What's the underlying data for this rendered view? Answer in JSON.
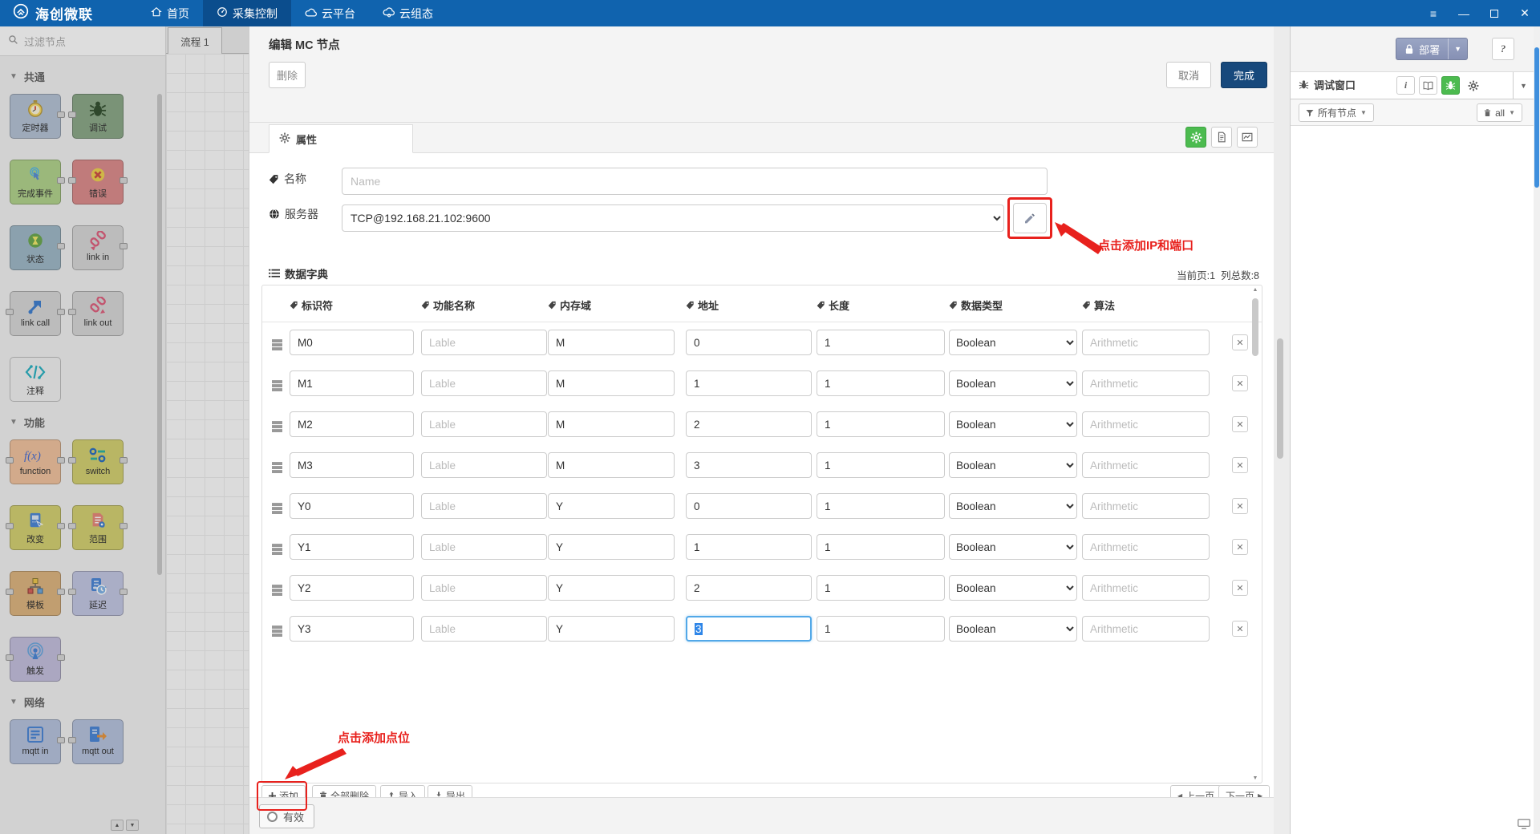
{
  "colors": {
    "navbar": "#1063ae",
    "navbar_active": "#0b4d8d",
    "done_button": "#17497c",
    "annotation_red": "#e8211d",
    "green": "#4cbb4f",
    "focus_blue": "#52a8e8",
    "selection_blue": "#2f86e8",
    "deploy": "#8e99bb"
  },
  "navbar": {
    "brand": "海创微联",
    "items": [
      {
        "label": "首页",
        "icon": "home-icon",
        "active": false
      },
      {
        "label": "采集控制",
        "icon": "gauge-icon",
        "active": true
      },
      {
        "label": "云平台",
        "icon": "cloud-icon",
        "active": false
      },
      {
        "label": "云组态",
        "icon": "cloud-gear-icon",
        "active": false
      }
    ]
  },
  "palette": {
    "search_placeholder": "过滤节点",
    "sections": [
      {
        "title": "共通",
        "nodes": [
          {
            "key": "timer",
            "label": "定时器",
            "color": "#b5c3d6",
            "icon": "timer",
            "ports": "r"
          },
          {
            "key": "debug",
            "label": "调试",
            "color": "#8ba888",
            "icon": "debug",
            "ports": "l"
          },
          {
            "key": "complete",
            "label": "完成事件",
            "color": "#b2d48c",
            "icon": "complete",
            "ports": "r"
          },
          {
            "key": "catch-error",
            "label": "错误",
            "color": "#dd8c8c",
            "icon": "error",
            "ports": "lr"
          },
          {
            "key": "status",
            "label": "状态",
            "color": "#9fb9c8",
            "icon": "status",
            "ports": "r"
          },
          {
            "key": "link-in",
            "label": "link in",
            "color": "#d9d9d9",
            "icon": "linkin",
            "ports": "r"
          },
          {
            "key": "link-call",
            "label": "link call",
            "color": "#d9d9d9",
            "icon": "linkcall",
            "ports": "lr"
          },
          {
            "key": "link-out",
            "label": "link out",
            "color": "#d9d9d9",
            "icon": "linkout",
            "ports": "l"
          },
          {
            "key": "comment",
            "label": "注释",
            "color": "#f2f2f2",
            "icon": "comment",
            "ports": ""
          }
        ]
      },
      {
        "title": "功能",
        "nodes": [
          {
            "key": "function",
            "label": "function",
            "color": "#f2c49f",
            "icon": "function",
            "ports": "lr"
          },
          {
            "key": "switch",
            "label": "switch",
            "color": "#d5d271",
            "icon": "switch",
            "ports": "lr"
          },
          {
            "key": "change",
            "label": "改变",
            "color": "#d5d271",
            "icon": "change",
            "ports": "lr"
          },
          {
            "key": "range",
            "label": "范围",
            "color": "#d5d271",
            "icon": "range",
            "ports": "lr"
          },
          {
            "key": "template",
            "label": "模板",
            "color": "#dfb57f",
            "icon": "template",
            "ports": "lr"
          },
          {
            "key": "delay",
            "label": "延迟",
            "color": "#c4c8e4",
            "icon": "delay",
            "ports": "lr"
          },
          {
            "key": "trigger",
            "label": "触发",
            "color": "#c5c0de",
            "icon": "trigger",
            "ports": "lr"
          }
        ]
      },
      {
        "title": "网络",
        "nodes": [
          {
            "key": "mqtt-in",
            "label": "mqtt in",
            "color": "#b7c3de",
            "icon": "mqttin",
            "ports": "r"
          },
          {
            "key": "mqtt-out",
            "label": "mqtt out",
            "color": "#b7c3de",
            "icon": "mqttout",
            "ports": "l"
          }
        ]
      }
    ]
  },
  "workspace": {
    "tab_label": "流程 1"
  },
  "dialog": {
    "title": "编辑 MC 节点",
    "delete_label": "删除",
    "cancel_label": "取消",
    "done_label": "完成",
    "props_tab": "属性",
    "fields": {
      "name_label": "名称",
      "name_placeholder": "Name",
      "server_label": "服务器",
      "server_value": "TCP@192.168.21.102:9600"
    },
    "annotations": {
      "ip_hint": "点击添加IP和端口",
      "add_hint": "点击添加点位"
    },
    "dict": {
      "title": "数据字典",
      "page_info": "当前页:1",
      "col_info": "列总数:8",
      "columns": [
        "标识符",
        "功能名称",
        "内存域",
        "地址",
        "长度",
        "数据类型",
        "算法"
      ],
      "label_placeholder": "Lable",
      "algorithm_placeholder": "Arithmetic",
      "datatype_value": "Boolean",
      "rows": [
        {
          "id": "M0",
          "domain": "M",
          "address": "0",
          "length": "1",
          "focused": false
        },
        {
          "id": "M1",
          "domain": "M",
          "address": "1",
          "length": "1",
          "focused": false
        },
        {
          "id": "M2",
          "domain": "M",
          "address": "2",
          "length": "1",
          "focused": false
        },
        {
          "id": "M3",
          "domain": "M",
          "address": "3",
          "length": "1",
          "focused": false
        },
        {
          "id": "Y0",
          "domain": "Y",
          "address": "0",
          "length": "1",
          "focused": false
        },
        {
          "id": "Y1",
          "domain": "Y",
          "address": "1",
          "length": "1",
          "focused": false
        },
        {
          "id": "Y2",
          "domain": "Y",
          "address": "2",
          "length": "1",
          "focused": false
        },
        {
          "id": "Y3",
          "domain": "Y",
          "address": "3",
          "length": "1",
          "focused": true
        }
      ],
      "footer": {
        "add": "添加",
        "delete_all": "全部删除",
        "import": "导入",
        "export": "导出",
        "prev": "上一页",
        "next": "下一页"
      }
    },
    "enabled_label": "有效"
  },
  "right_panel": {
    "deploy_label": "部署",
    "debug_tab": "调试窗口",
    "filter_nodes": "所有节点",
    "clear_label": "all"
  }
}
